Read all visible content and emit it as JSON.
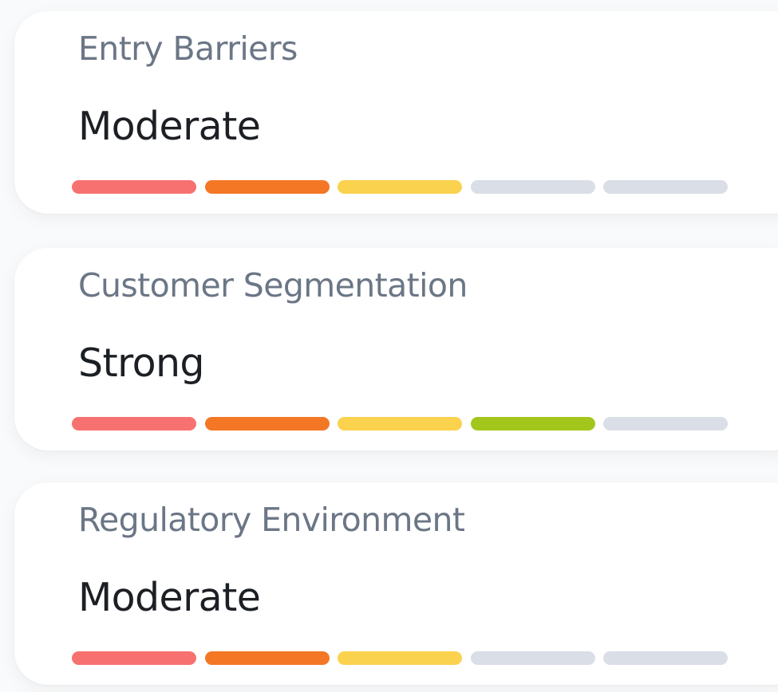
{
  "scale": {
    "segment_count": 5,
    "segment_colors": [
      "#f87171",
      "#f47726",
      "#fbd24e",
      "#a3c61d",
      "#d9dee7"
    ],
    "inactive_color": "#d9dee7"
  },
  "cards": [
    {
      "title": "Entry Barriers",
      "value": "Moderate",
      "level": 3
    },
    {
      "title": "Customer Segmentation",
      "value": "Strong",
      "level": 4
    },
    {
      "title": "Regulatory Environment",
      "value": "Moderate",
      "level": 3
    }
  ]
}
